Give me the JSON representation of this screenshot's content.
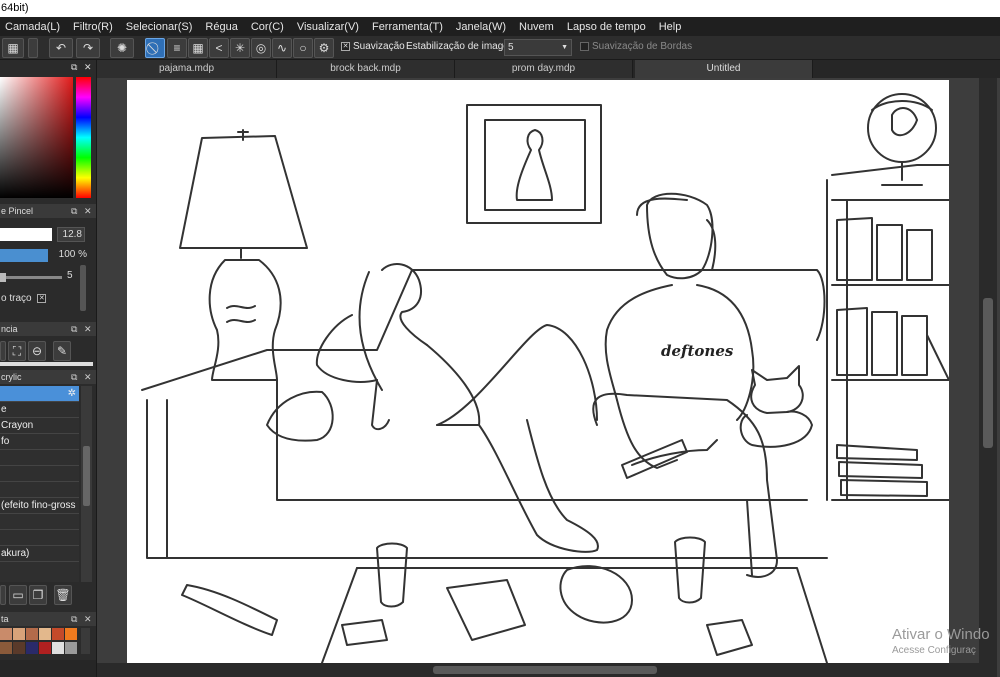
{
  "title_bar": "64bit)",
  "menu": [
    "Camada(L)",
    "Filtro(R)",
    "Selecionar(S)",
    "Régua",
    "Cor(C)",
    "Visualizar(V)",
    "Ferramenta(T)",
    "Janela(W)",
    "Nuvem",
    "Lapso de tempo",
    "Help"
  ],
  "toolbar": {
    "suavizacao_label": "Suavização",
    "estabilizacao_label": "Estabilização de imagens",
    "estabilizacao_value": "5",
    "suavizacao_bordas_label": "Suavização de Bordas"
  },
  "tabs": [
    "pajama.mdp",
    "brock back.mdp",
    "prom day.mdp",
    "Untitled"
  ],
  "active_tab": "Untitled",
  "brush_panel": {
    "title": "e Pincel",
    "size_value": "12.8",
    "opacity_value": "100 %",
    "slider3_value": "5",
    "stroke_label": "o traço"
  },
  "nav_panel": {
    "title": "ncia"
  },
  "brush_list": {
    "title": "crylic",
    "items": [
      "",
      "e",
      "Crayon",
      "fo",
      "",
      "",
      "",
      "(efeito fino-gross",
      "",
      "",
      "akura)"
    ]
  },
  "color_panel": {
    "title": "ta"
  },
  "swatch_colors": [
    "#c98b6a",
    "#d8a37a",
    "#b36b4a",
    "#e3b88c",
    "#c44a2a",
    "#f07a1e",
    "#8a5a3a",
    "#5a3a2a",
    "#2a2a6a",
    "#b02020",
    "#e0e0e0",
    "#9a9a9a"
  ],
  "drawing_text": "deftones",
  "watermark": {
    "line1": "Ativar o Windo",
    "line2": "Acesse Configuraç"
  }
}
